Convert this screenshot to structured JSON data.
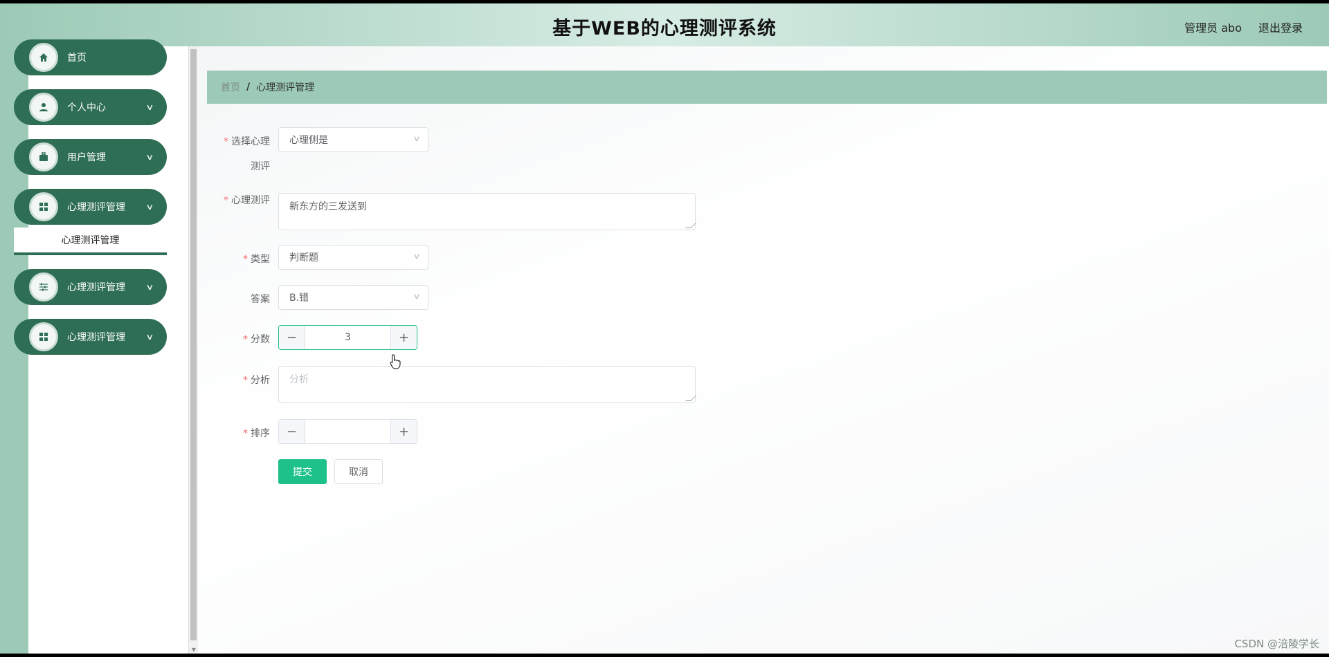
{
  "header": {
    "title": "基于WEB的心理测评系统",
    "user_label": "管理员 abo",
    "logout_label": "退出登录"
  },
  "sidebar": {
    "items": [
      {
        "label": "首页",
        "icon": "home-icon",
        "has_arrow": false
      },
      {
        "label": "个人中心",
        "icon": "user-icon",
        "has_arrow": true
      },
      {
        "label": "用户管理",
        "icon": "briefcase-icon",
        "has_arrow": true
      },
      {
        "label": "心理测评管理",
        "icon": "grid-icon",
        "has_arrow": true
      },
      {
        "label": "心理测评管理",
        "icon": "sliders-icon",
        "has_arrow": true
      },
      {
        "label": "心理测评管理",
        "icon": "grid-icon",
        "has_arrow": true
      }
    ],
    "submenu_active": "心理测评管理"
  },
  "breadcrumb": {
    "home": "首页",
    "separator": "/",
    "current": "心理测评管理"
  },
  "form": {
    "select_test": {
      "label_line1": "选择心理",
      "label_line2": "测评",
      "value": "心理侧是"
    },
    "test_content": {
      "label": "心理测评",
      "value": "新东方的三发送到"
    },
    "type": {
      "label": "类型",
      "value": "判断题"
    },
    "answer": {
      "label": "答案",
      "value": "B.错"
    },
    "score": {
      "label": "分数",
      "value": "3"
    },
    "analysis": {
      "label": "分析",
      "placeholder": "分析"
    },
    "order": {
      "label": "排序",
      "value": ""
    },
    "submit_label": "提交",
    "cancel_label": "取消"
  },
  "watermark": "CSDN @涪陵学长",
  "colors": {
    "header_gradient": "#9ccab6",
    "menu_bg": "#2e6e55",
    "primary": "#1ec18a",
    "breadcrumb_bg": "#9ccab6"
  }
}
